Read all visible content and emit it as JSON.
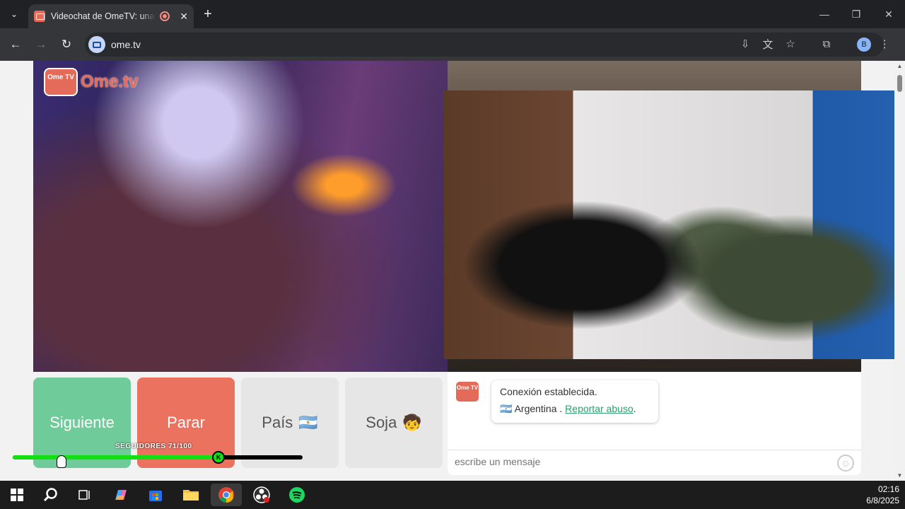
{
  "browser": {
    "tab": {
      "title": "Videochat de OmeTV: una a",
      "close": "✕"
    },
    "new_tab": "+",
    "tab_menu": "⌄",
    "window": {
      "minimize": "—",
      "maximize": "❐",
      "close": "✕"
    },
    "url": "ome.tv",
    "profile_initial": "B"
  },
  "page": {
    "logo": {
      "tv_text": "Ome TV",
      "text": "Ome.tv"
    },
    "buttons": {
      "next": "Siguiente",
      "stop": "Parar",
      "country": "País",
      "country_flag": "🇦🇷",
      "gender": "Soja",
      "gender_emoji": "🧒"
    },
    "chat": {
      "avatar_text": "Ome TV",
      "message_line1": "Conexión establecida.",
      "flag": "🇦🇷",
      "country": "Argentina",
      "country_sep": " . ",
      "report_link": "Reportar abuso",
      "report_suffix": ".",
      "placeholder": "escribe un mensaje",
      "smiley": "☺"
    }
  },
  "overlay": {
    "followers_label": "SEGUIDORES 71/100",
    "followers_current": 71,
    "followers_goal": 100,
    "knob_letter": "K"
  },
  "taskbar": {
    "time": "02:16",
    "date": "6/8/2025",
    "apps": [
      "windows-start",
      "search",
      "task-view",
      "copilot",
      "microsoft-store",
      "file-explorer",
      "chrome",
      "obs-studio",
      "spotify"
    ]
  },
  "colors": {
    "next_button": "#6fcc9a",
    "stop_button": "#ec7260",
    "brand": "#e46a5a",
    "progress": "#12e012"
  }
}
